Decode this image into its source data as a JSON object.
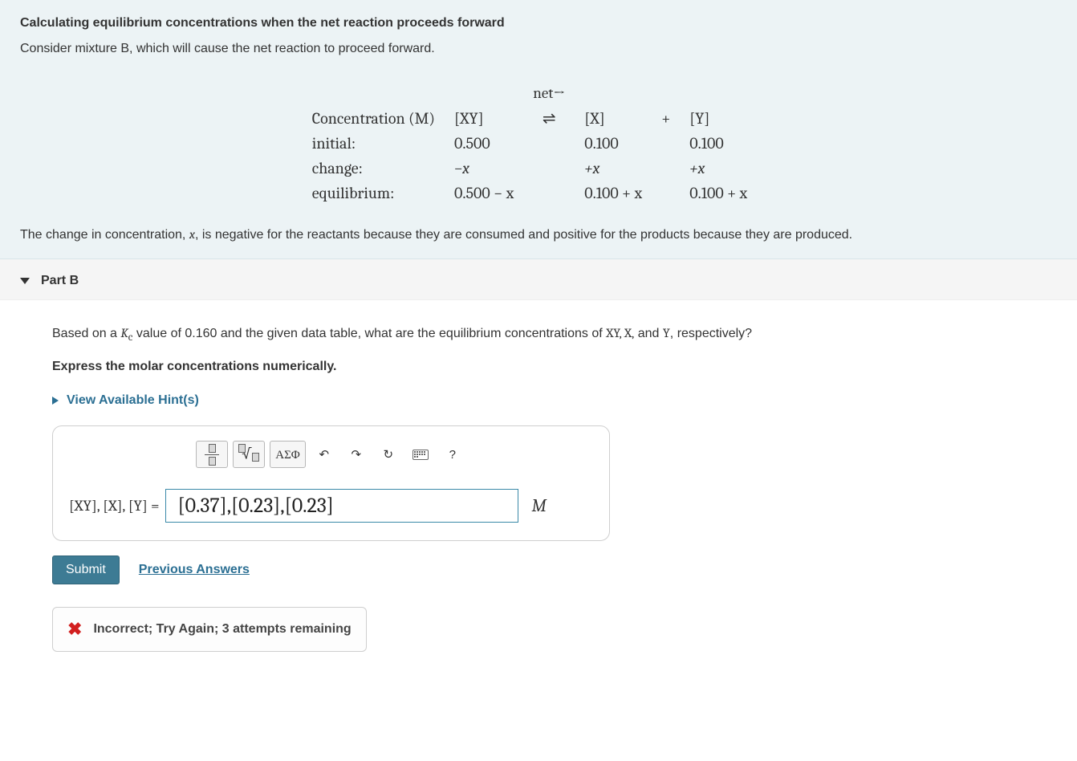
{
  "intro": {
    "title": "Calculating equilibrium concentrations when the net reaction proceeds forward",
    "subtitle": "Consider mixture B, which will cause the net reaction to proceed forward.",
    "footnote_pre": "The change in concentration, ",
    "footnote_var": "x",
    "footnote_post": ", is negative for the reactants because they are consumed and positive for the products because they are produced."
  },
  "ice": {
    "net_label": "net→",
    "header": {
      "c0": "Concentration (M)",
      "c1": "[XY]",
      "c2": "⇌",
      "c3": "[X]",
      "c4": "+",
      "c5": "[Y]"
    },
    "rows": [
      {
        "label": "initial:",
        "xy": "0.500",
        "x": "0.100",
        "y": "0.100"
      },
      {
        "label": "change:",
        "xy": "−x",
        "x": "+x",
        "y": "+x"
      },
      {
        "label": "equilibrium:",
        "xy": "0.500 − x",
        "x": "0.100 + x",
        "y": "0.100 + x"
      }
    ]
  },
  "part": {
    "title": "Part B",
    "question_pre": "Based on a ",
    "kc_sym": "K",
    "kc_sub": "c",
    "question_mid": " value of 0.160 and the given data table, what are the equilibrium concentrations of ",
    "species": "XY, X,",
    "and_word": " and ",
    "species_last": "Y",
    "question_post": ", respectively?",
    "instruction": "Express the molar concentrations numerically.",
    "hints_label": "View Available Hint(s)"
  },
  "toolbar": {
    "greek_label": "ΑΣΦ",
    "help_label": "?"
  },
  "answer": {
    "lhs": "[XY], [X], [Y] =",
    "value": "[0.37],[0.23],[0.23]",
    "unit": "M"
  },
  "actions": {
    "submit": "Submit",
    "previous": "Previous Answers"
  },
  "feedback": {
    "icon": "✖",
    "text": "Incorrect; Try Again; 3 attempts remaining"
  }
}
